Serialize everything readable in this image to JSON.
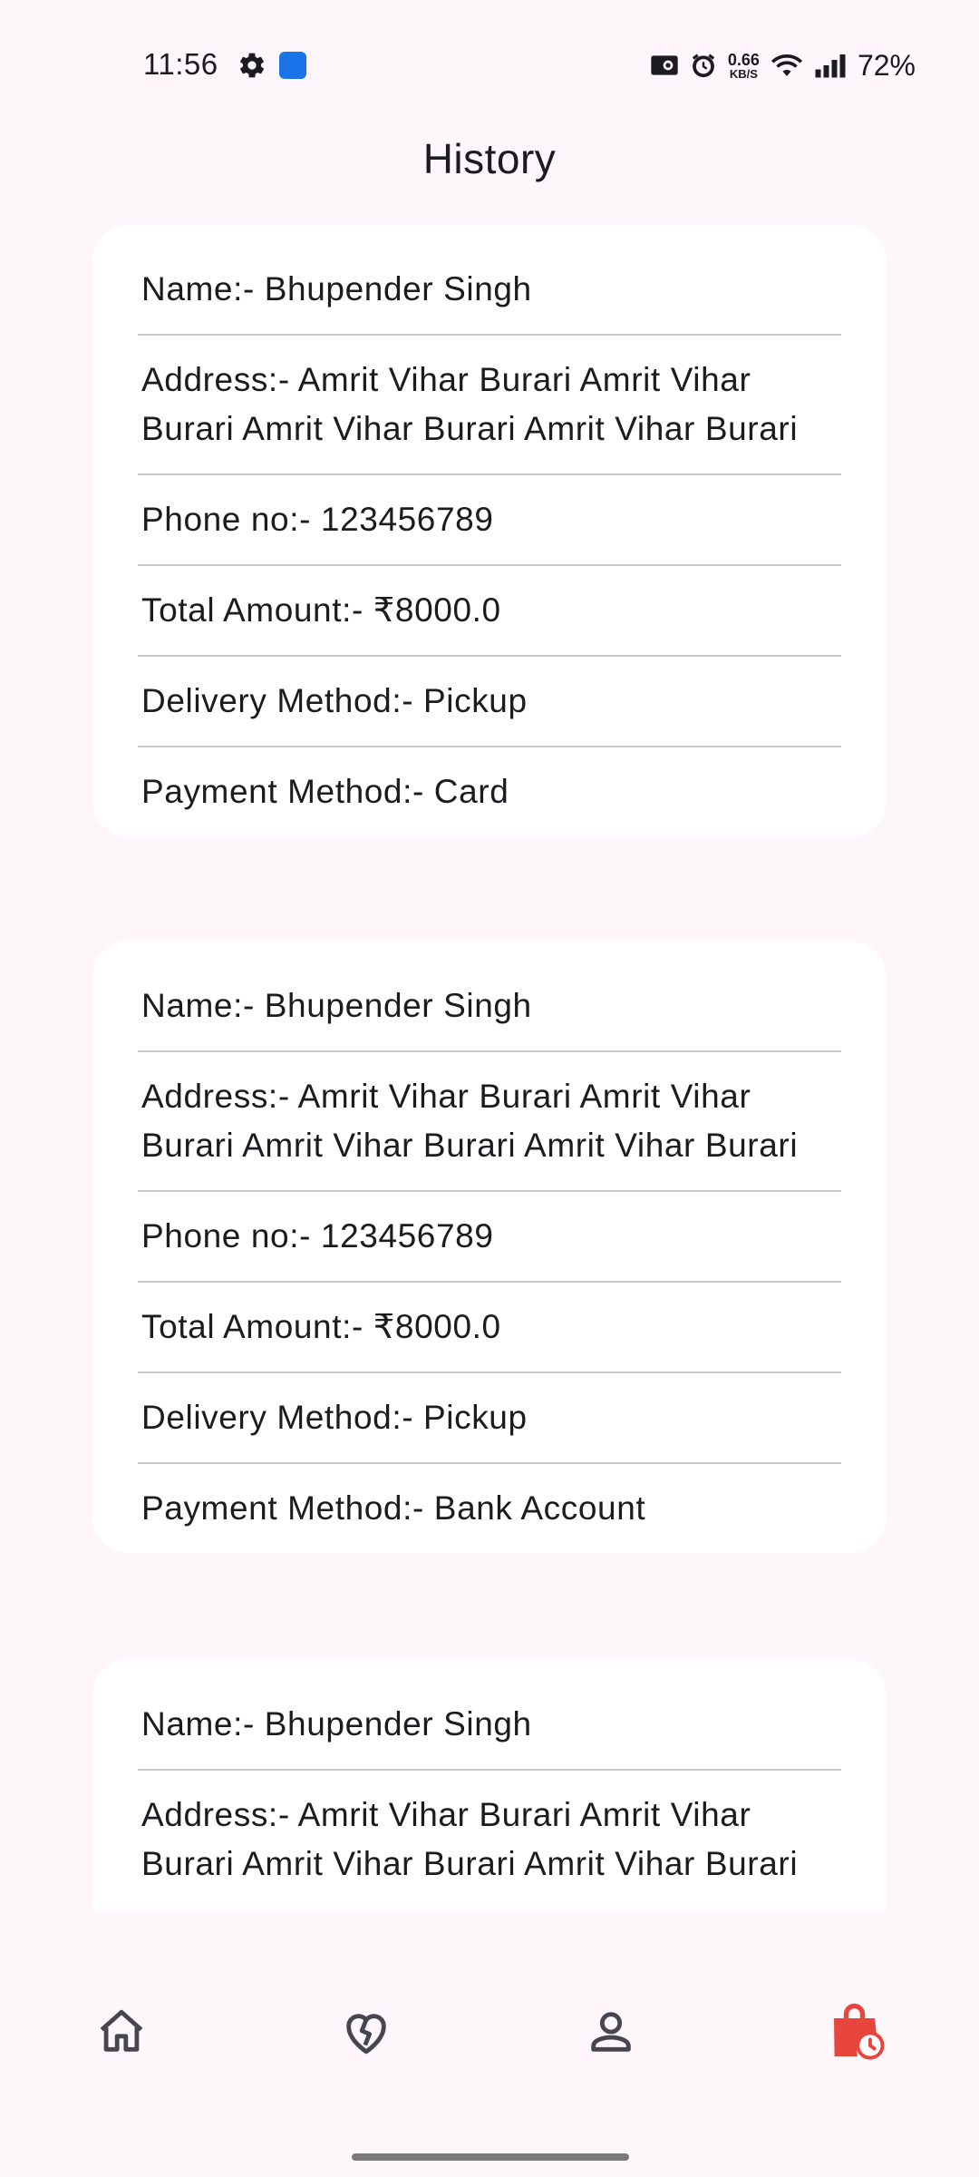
{
  "status_bar": {
    "time": "11:56",
    "net_speed_value": "0.66",
    "net_speed_unit": "KB/S",
    "battery": "72%"
  },
  "page": {
    "title": "History"
  },
  "orders": [
    {
      "name": "Name:- Bhupender Singh",
      "address": "Address:- Amrit Vihar Burari Amrit Vihar Burari Amrit Vihar Burari Amrit Vihar Burari",
      "phone": "Phone no:- 123456789",
      "total": "Total Amount:- ₹8000.0",
      "delivery": "Delivery Method:- Pickup",
      "payment": "Payment Method:- Card"
    },
    {
      "name": "Name:- Bhupender Singh",
      "address": "Address:- Amrit Vihar Burari Amrit Vihar Burari Amrit Vihar Burari Amrit Vihar Burari",
      "phone": "Phone no:- 123456789",
      "total": "Total Amount:- ₹8000.0",
      "delivery": "Delivery Method:- Pickup",
      "payment": "Payment Method:- Bank Account"
    },
    {
      "name": "Name:- Bhupender Singh",
      "address": "Address:- Amrit Vihar Burari Amrit Vihar Burari Amrit Vihar Burari Amrit Vihar Burari"
    }
  ],
  "bottom_nav": {
    "items": [
      {
        "icon": "home-icon",
        "active": false
      },
      {
        "icon": "heart-broken-icon",
        "active": false
      },
      {
        "icon": "person-icon",
        "active": false
      },
      {
        "icon": "order-history-icon",
        "active": true
      }
    ],
    "active_color": "#e8453c",
    "inactive_color": "#45464f"
  }
}
